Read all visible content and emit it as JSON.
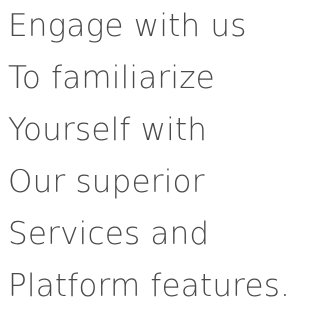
{
  "headline": {
    "lines": [
      "Engage with us",
      "To familiarize",
      "Yourself with",
      "Our superior",
      "Services and",
      "Platform features."
    ]
  },
  "colors": {
    "text": "#4a4a4a",
    "background": "#ffffff"
  }
}
